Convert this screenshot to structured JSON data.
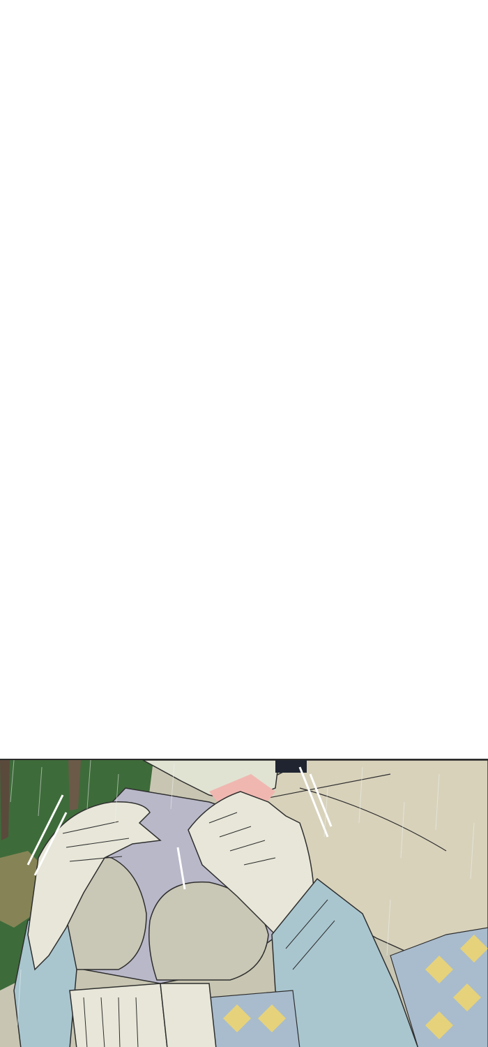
{
  "page": {
    "background": "#ffffff"
  },
  "panel": {
    "scene": "rain-embrace-closeup",
    "colors": {
      "grass": "#3e6b3a",
      "tree_trunk": "#5a4a3c",
      "coat": "#d8d2bb",
      "sweater": "#b9b8c9",
      "sleeve": "#a9c6cf",
      "skin": "#e7e6d8",
      "blush": "#f0b7b0",
      "argyle_yellow": "#e6d27a",
      "argyle_blue": "#a9bccd",
      "line": "#2e2e2e",
      "rain": "#eef2f0"
    }
  }
}
